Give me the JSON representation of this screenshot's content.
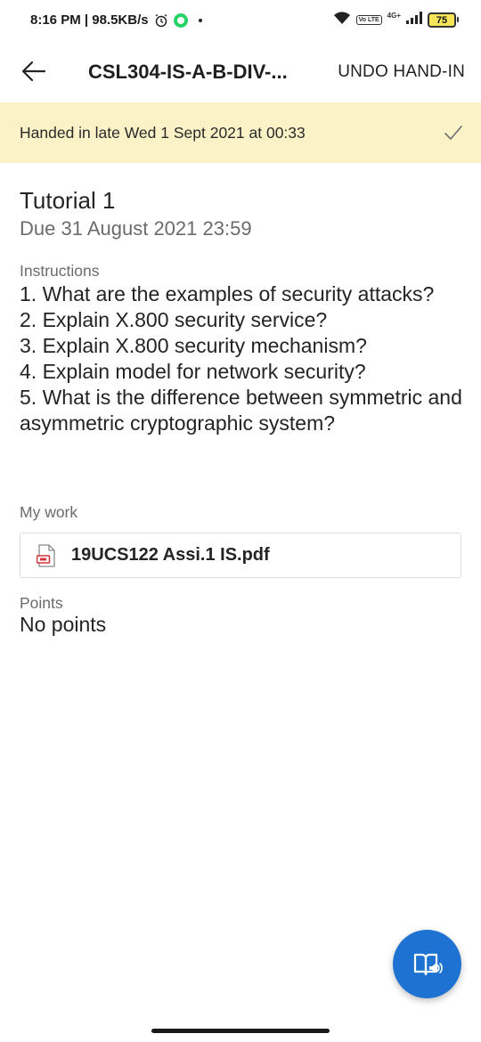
{
  "status_bar": {
    "time_speed": "8:16 PM | 98.5KB/s",
    "volte": "Vo LTE",
    "network": "4G+",
    "battery": "75"
  },
  "app_bar": {
    "title": "CSL304-IS-A-B-DIV-...",
    "undo_label": "UNDO HAND-IN"
  },
  "banner": {
    "text": "Handed in late Wed 1 Sept 2021 at 00:33"
  },
  "assignment": {
    "title": "Tutorial 1",
    "due": "Due 31 August 2021 23:59",
    "instructions_label": "Instructions",
    "instructions": [
      "1. What are the examples of security attacks?",
      "2. Explain X.800 security service?",
      "3. Explain X.800 security mechanism?",
      "4. Explain model for network security?",
      "5. What is the difference between symmetric and asymmetric cryptographic system?"
    ],
    "my_work_label": "My work",
    "file_name": "19UCS122 Assi.1 IS.pdf",
    "points_label": "Points",
    "points_value": "No points"
  },
  "icons": {
    "back": "arrow-left-icon",
    "check": "check-icon",
    "pdf": "pdf-file-icon",
    "fab": "immersive-reader-icon"
  },
  "colors": {
    "banner_bg": "#fcf2c7",
    "fab_bg": "#1e73d2",
    "secondary_text": "#6b6b6b"
  }
}
